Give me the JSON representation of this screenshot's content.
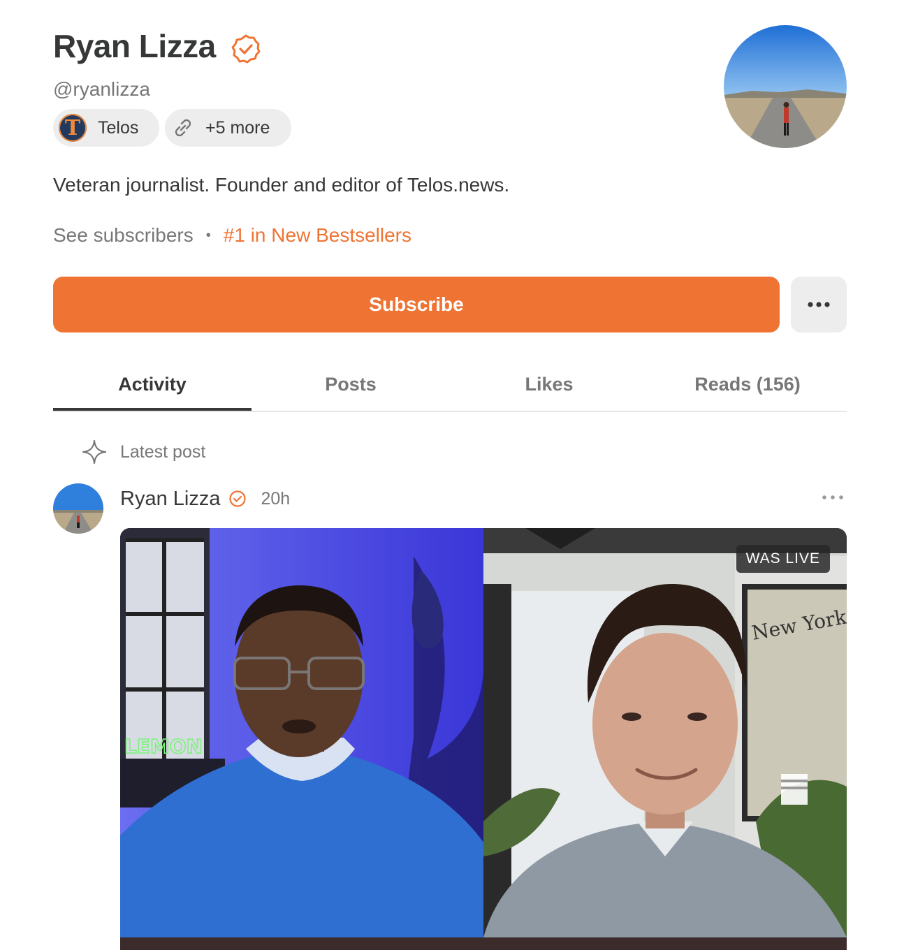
{
  "profile": {
    "name": "Ryan Lizza",
    "handle": "@ryanlizza",
    "verified_icon": "verified-check-icon",
    "bio": "Veteran journalist. Founder and editor of Telos.news.",
    "see_subscribers": "See subscribers",
    "separator": "•",
    "bestseller": "#1 in New Bestsellers"
  },
  "pills": {
    "publication": "Telos",
    "publication_logo_letter": "T",
    "more_links": "+5 more"
  },
  "actions": {
    "subscribe": "Subscribe",
    "more_icon": "more-horizontal-icon"
  },
  "tabs": [
    {
      "label": "Activity",
      "active": true
    },
    {
      "label": "Posts",
      "active": false
    },
    {
      "label": "Likes",
      "active": false
    },
    {
      "label": "Reads (156)",
      "active": false
    }
  ],
  "feed": {
    "section_label": "Latest post",
    "section_icon": "sparkle-icon",
    "post": {
      "author": "Ryan Lizza",
      "time": "20h",
      "badge": "WAS LIVE",
      "neon_sign": "LEMON",
      "map_text": "New York City"
    }
  },
  "colors": {
    "accent": "#ef7433",
    "text": "#363737",
    "muted": "#777777",
    "pill_bg": "#ededed"
  }
}
